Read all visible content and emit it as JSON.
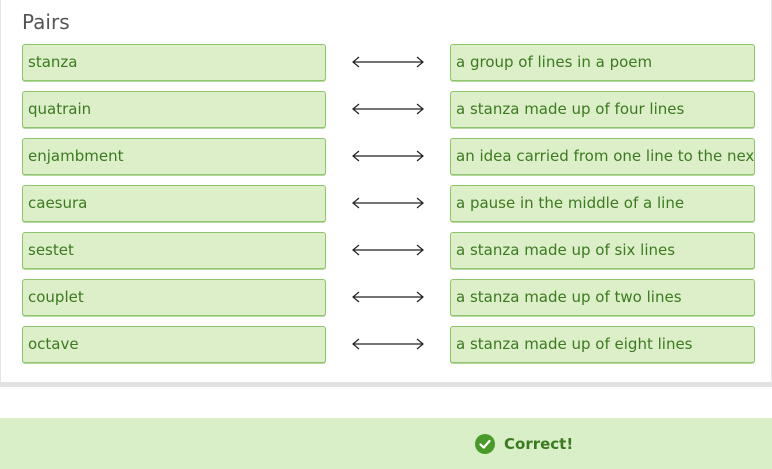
{
  "section": {
    "title": "Pairs"
  },
  "pairs": [
    {
      "term": "stanza",
      "definition": "a group of lines in a poem"
    },
    {
      "term": "quatrain",
      "definition": "a stanza made up of four lines"
    },
    {
      "term": "enjambment",
      "definition": "an idea carried from one line to the next"
    },
    {
      "term": "caesura",
      "definition": "a pause in the middle of a line"
    },
    {
      "term": "sestet",
      "definition": "a stanza made up of six lines"
    },
    {
      "term": "couplet",
      "definition": "a stanza made up of two lines"
    },
    {
      "term": "octave",
      "definition": "a stanza made up of eight lines"
    }
  ],
  "feedback": {
    "status": "Correct!",
    "icon": "check-circle-icon"
  },
  "colors": {
    "tile_background": "#dcefc9",
    "tile_border": "#8cc56a",
    "text_green": "#3b7a1f",
    "footer_background": "#d9efc8",
    "check_green": "#4a9a2a"
  }
}
